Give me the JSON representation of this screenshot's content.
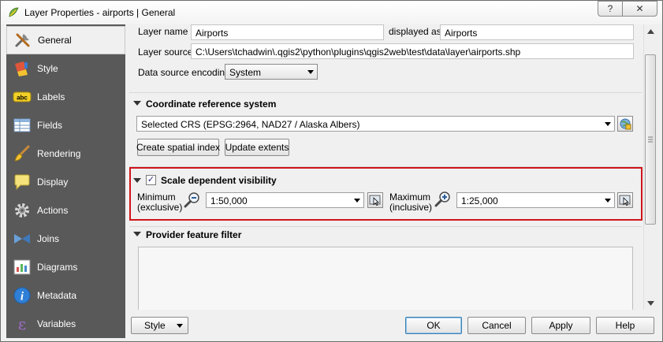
{
  "window": {
    "title": "Layer Properties - airports | General",
    "help_label": "?",
    "close_label": "✕"
  },
  "sidebar": {
    "items": [
      {
        "label": "General",
        "icon": "tools-icon"
      },
      {
        "label": "Style",
        "icon": "paint-icon"
      },
      {
        "label": "Labels",
        "icon": "abc-icon"
      },
      {
        "label": "Fields",
        "icon": "table-icon"
      },
      {
        "label": "Rendering",
        "icon": "brush-icon"
      },
      {
        "label": "Display",
        "icon": "speech-bubble-icon"
      },
      {
        "label": "Actions",
        "icon": "gear-icon"
      },
      {
        "label": "Joins",
        "icon": "join-icon"
      },
      {
        "label": "Diagrams",
        "icon": "diagram-icon"
      },
      {
        "label": "Metadata",
        "icon": "info-icon"
      },
      {
        "label": "Variables",
        "icon": "epsilon-icon"
      }
    ]
  },
  "general": {
    "layer_name_label": "Layer name",
    "layer_name_value": "Airports",
    "displayed_as_label": "displayed as",
    "displayed_as_value": "Airports",
    "layer_source_label": "Layer source",
    "layer_source_value": "C:\\Users\\tchadwin\\.qgis2\\python\\plugins\\qgis2web\\test\\data\\layer\\airports.shp",
    "encoding_label": "Data source encoding",
    "encoding_value": "System"
  },
  "crs": {
    "title": "Coordinate reference system",
    "selected": "Selected CRS (EPSG:2964, NAD27 / Alaska Albers)",
    "create_index_label": "Create spatial index",
    "update_extents_label": "Update extents"
  },
  "scale": {
    "title": "Scale dependent visibility",
    "checked": true,
    "check_mark": "✓",
    "minimum_label_1": "Minimum",
    "minimum_label_2": "(exclusive)",
    "minimum_value": "1:50,000",
    "maximum_label_1": "Maximum",
    "maximum_label_2": "(inclusive)",
    "maximum_value": "1:25,000"
  },
  "filter": {
    "title": "Provider feature filter"
  },
  "buttons": {
    "style": "Style",
    "ok": "OK",
    "cancel": "Cancel",
    "apply": "Apply",
    "help": "Help"
  },
  "colors": {
    "sidebar_bg": "#595959",
    "highlight_border": "#d0141c"
  }
}
